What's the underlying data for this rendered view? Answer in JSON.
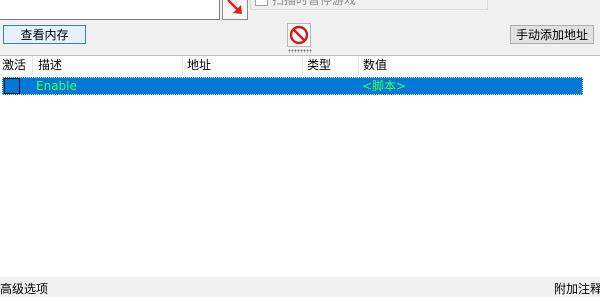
{
  "scan": {
    "pause_label": "扫描时暂停游戏"
  },
  "buttons": {
    "view_memory": "查看内存",
    "manual_add": "手动添加地址"
  },
  "table": {
    "columns": {
      "active": "激活",
      "description": "描述",
      "address": "地址",
      "type": "类型",
      "value": "数值"
    },
    "rows": [
      {
        "active": false,
        "description": "Enable",
        "address": "",
        "type": "",
        "value": "<脚本>"
      }
    ],
    "selected_row_color": "#0078d7",
    "script_text_color": "#3fff4d"
  },
  "footer": {
    "advanced_options": "高级选项",
    "add_comment": "附加注释"
  },
  "icons": {
    "arrow": "red-arrow-icon",
    "clear": "no-entry-icon"
  }
}
